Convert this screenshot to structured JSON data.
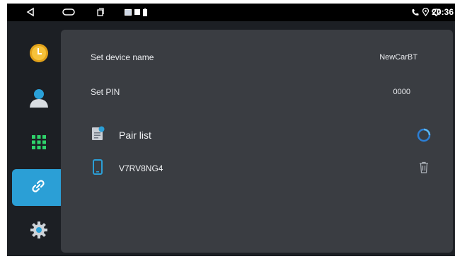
{
  "status_bar": {
    "time": "20:36",
    "icons": [
      "back-icon",
      "home-icon",
      "recents-icon",
      "image-icon",
      "sim-icon",
      "battery-icon",
      "phone-icon",
      "location-icon",
      "wifi-icon"
    ]
  },
  "sidebar": {
    "items": [
      {
        "name": "clock",
        "icon": "clock-icon",
        "active": false
      },
      {
        "name": "contacts",
        "icon": "contact-icon",
        "active": false
      },
      {
        "name": "dialpad",
        "icon": "dialpad-icon",
        "active": false
      },
      {
        "name": "link",
        "icon": "link-icon",
        "active": true
      },
      {
        "name": "settings",
        "icon": "gear-icon",
        "active": false
      }
    ]
  },
  "settings": {
    "device_name_label": "Set device name",
    "device_name_value": "NewCarBT",
    "pin_label": "Set PIN",
    "pin_value": "0000"
  },
  "pair_list": {
    "title": "Pair list",
    "devices": [
      {
        "name": "V7RV8NG4"
      }
    ]
  },
  "colors": {
    "accent": "#2b9fd6",
    "panel": "#3a3d42",
    "background": "#1c1f24",
    "text": "#e9ebee"
  }
}
